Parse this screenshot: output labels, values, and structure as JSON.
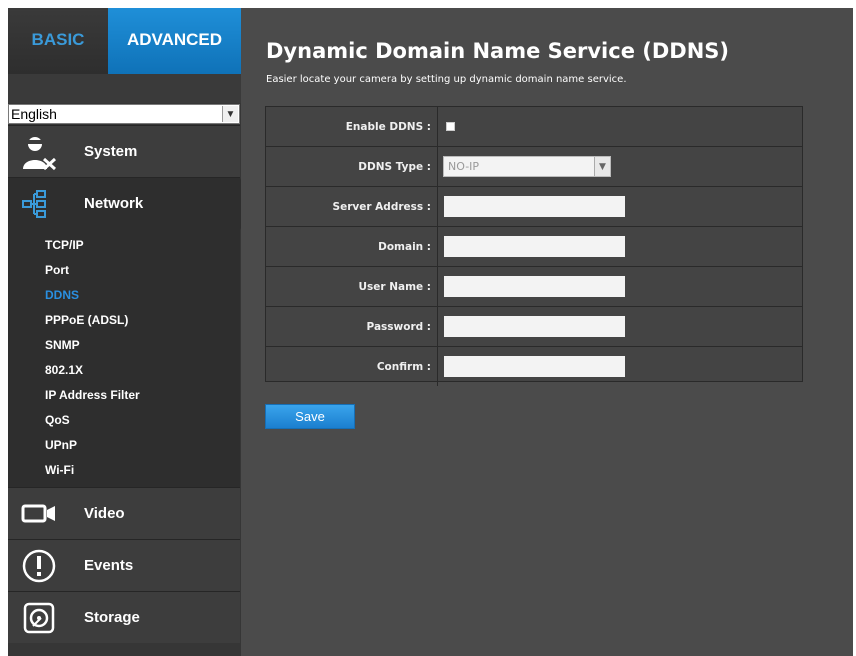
{
  "tabs": {
    "basic": "BASIC",
    "advanced": "ADVANCED"
  },
  "language": {
    "selected": "English"
  },
  "menu": {
    "system": "System",
    "network": "Network",
    "video": "Video",
    "events": "Events",
    "storage": "Storage"
  },
  "network_submenu": [
    "TCP/IP",
    "Port",
    "DDNS",
    "PPPoE (ADSL)",
    "SNMP",
    "802.1X",
    "IP Address Filter",
    "QoS",
    "UPnP",
    "Wi-Fi"
  ],
  "page": {
    "title": "Dynamic Domain Name Service (DDNS)",
    "subtitle": "Easier locate your camera by setting up dynamic domain name service."
  },
  "form": {
    "enable_label": "Enable DDNS :",
    "enable_checked": false,
    "type_label": "DDNS Type :",
    "type_value": "NO-IP",
    "server_label": "Server Address :",
    "server_value": "",
    "domain_label": "Domain :",
    "domain_value": "",
    "username_label": "User Name :",
    "username_value": "",
    "password_label": "Password :",
    "password_value": "",
    "confirm_label": "Confirm :",
    "confirm_value": ""
  },
  "save_label": "Save",
  "colors": {
    "accent": "#1f8fd8",
    "selected_sub": "#2a8fe0",
    "panel": "#4b4b4b"
  }
}
